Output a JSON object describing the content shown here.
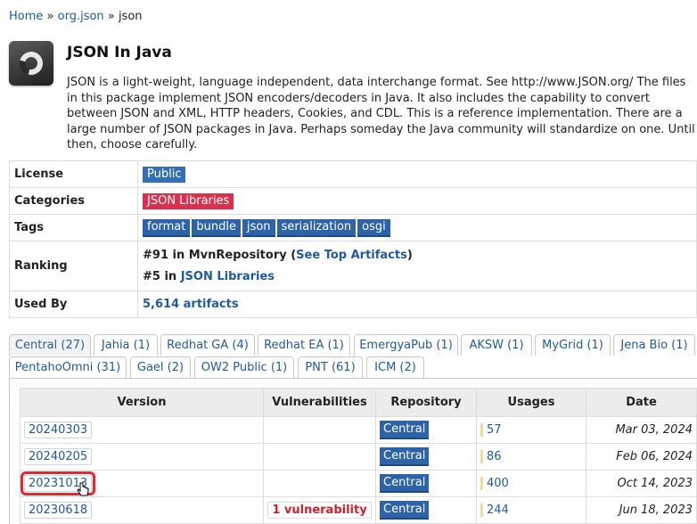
{
  "breadcrumb": {
    "home": "Home",
    "sep1": "»",
    "group": "org.json",
    "sep2": "»",
    "artifact": "json"
  },
  "header": {
    "title": "JSON In Java",
    "description": "JSON is a light-weight, language independent, data interchange format. See http://www.JSON.org/ The files in this package implement JSON encoders/decoders in Java. It also includes the capability to convert between JSON and XML, HTTP headers, Cookies, and CDL. This is a reference implementation. There are a large number of JSON packages in Java. Perhaps someday the Java community will standardize on one. Until then, choose carefully."
  },
  "info": {
    "license_label": "License",
    "license": "Public",
    "categories_label": "Categories",
    "category": "JSON Libraries",
    "tags_label": "Tags",
    "tags": [
      "format",
      "bundle",
      "json",
      "serialization",
      "osgi"
    ],
    "ranking_label": "Ranking",
    "rank1_prefix": "#91 in MvnRepository (",
    "rank1_link": "See Top Artifacts",
    "rank1_suffix": ")",
    "rank2_prefix": "#5 in ",
    "rank2_link": "JSON Libraries",
    "usedby_label": "Used By",
    "usedby": "5,614 artifacts"
  },
  "tabs": [
    "Central (27)",
    "Jahia (1)",
    "Redhat GA (4)",
    "Redhat EA (1)",
    "EmergyaPub (1)",
    "AKSW (1)",
    "MyGrid (1)",
    "Jena Bio (1)",
    "PentahoOmni (31)",
    "Gael (2)",
    "OW2 Public (1)",
    "PNT (61)",
    "ICM (2)"
  ],
  "versions": {
    "headers": {
      "version": "Version",
      "vulns": "Vulnerabilities",
      "repo": "Repository",
      "usages": "Usages",
      "date": "Date"
    },
    "rows": [
      {
        "version": "20240303",
        "vuln": "",
        "repo": "Central",
        "usages": "57",
        "date": "Mar 03, 2024"
      },
      {
        "version": "20240205",
        "vuln": "",
        "repo": "Central",
        "usages": "86",
        "date": "Feb 06, 2024"
      },
      {
        "version": "20231013",
        "vuln": "",
        "repo": "Central",
        "usages": "400",
        "date": "Oct 14, 2023"
      },
      {
        "version": "20230618",
        "vuln": "1 vulnerability",
        "repo": "Central",
        "usages": "244",
        "date": "Jun 18, 2023"
      }
    ]
  }
}
